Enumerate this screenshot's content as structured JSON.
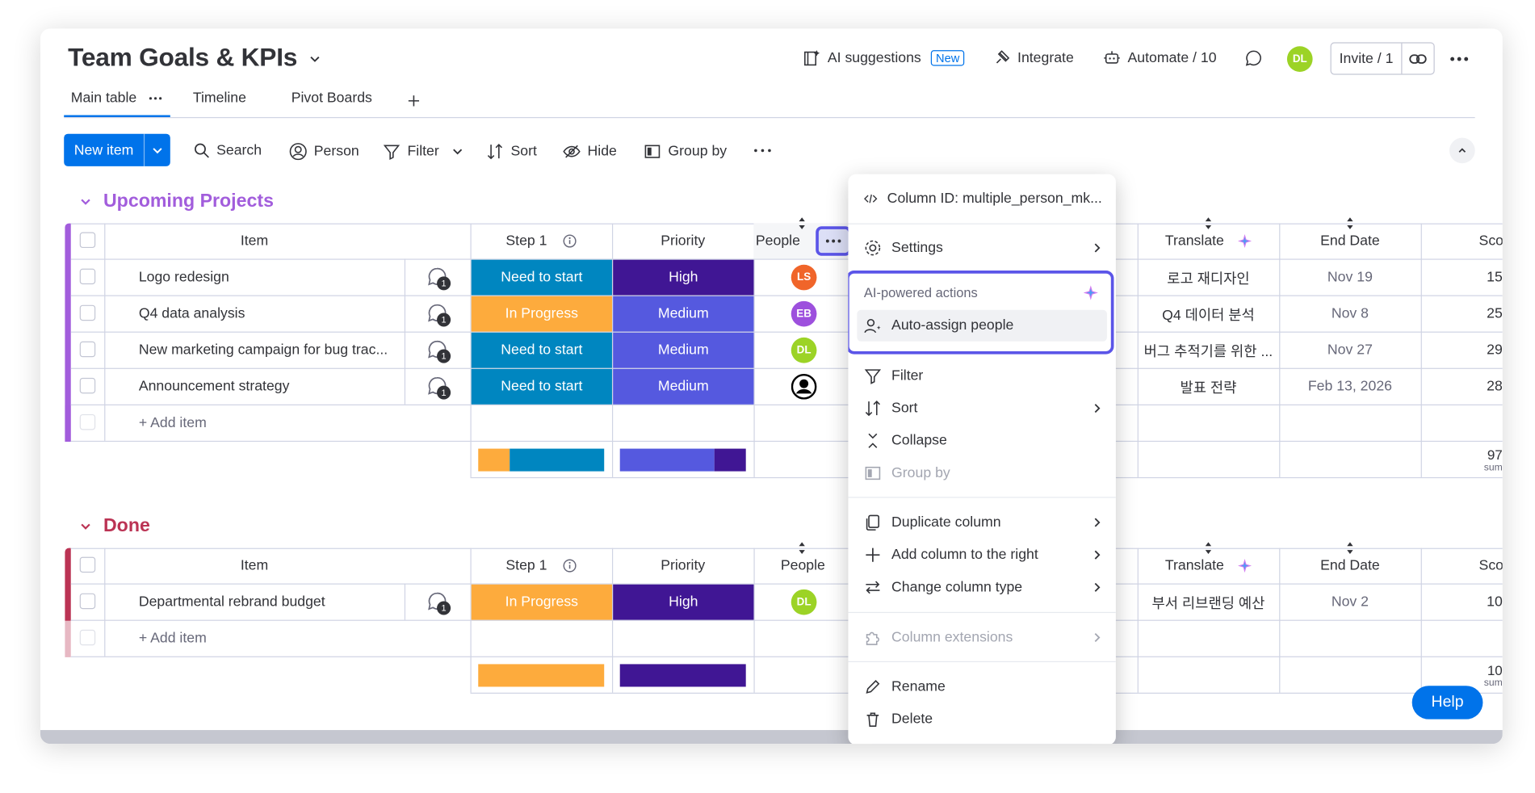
{
  "board": {
    "title": "Team Goals & KPIs",
    "ai_suggestions": "AI suggestions",
    "new_badge": "New",
    "integrate": "Integrate",
    "automate": "Automate / 10",
    "user_initials": "DL",
    "invite": "Invite / 1"
  },
  "tabs": [
    "Main table",
    "Timeline",
    "Pivot Boards"
  ],
  "toolbar": {
    "new_item": "New item",
    "search": "Search",
    "person": "Person",
    "filter": "Filter",
    "sort": "Sort",
    "hide": "Hide",
    "group_by": "Group by"
  },
  "columns": {
    "item": "Item",
    "step1": "Step 1",
    "priority": "Priority",
    "people": "People",
    "translate": "Translate",
    "end_date": "End Date",
    "score": "Score"
  },
  "groups": [
    {
      "name": "Upcoming Projects",
      "color": "#a25ddc",
      "rows": [
        {
          "item": "Logo redesign",
          "updates": "1",
          "step": "Need to start",
          "step_color": "#0086c0",
          "priority": "High",
          "priority_color": "#401694",
          "person": "LS",
          "person_color": "#f0652a",
          "translate": "로고 재디자인",
          "end": "Nov 19",
          "score": "15"
        },
        {
          "item": "Q4 data analysis",
          "updates": "1",
          "step": "In Progress",
          "step_color": "#fdab3d",
          "priority": "Medium",
          "priority_color": "#5559df",
          "person": "EB",
          "person_color": "#9d50dd",
          "translate": "Q4 데이터 분석",
          "end": "Nov 8",
          "score": "25"
        },
        {
          "item": "New marketing campaign for bug trac...",
          "updates": "1",
          "step": "Need to start",
          "step_color": "#0086c0",
          "priority": "Medium",
          "priority_color": "#5559df",
          "person": "DL",
          "person_color": "#9cd326",
          "translate": "버그 추적기를 위한 ...",
          "end": "Nov 27",
          "score": "29"
        },
        {
          "item": "Announcement strategy",
          "updates": "1",
          "step": "Need to start",
          "step_color": "#0086c0",
          "priority": "Medium",
          "priority_color": "#5559df",
          "person": "",
          "person_color": "#ffffff",
          "translate": "발표 전략",
          "end": "Feb 13, 2026",
          "score": "28"
        }
      ],
      "add_item": "+ Add item",
      "summary_score": "97",
      "summary_label": "sum"
    },
    {
      "name": "Done",
      "color": "#bb3354",
      "rows": [
        {
          "item": "Departmental rebrand budget",
          "updates": "1",
          "step": "In Progress",
          "step_color": "#fdab3d",
          "priority": "High",
          "priority_color": "#401694",
          "person": "DL",
          "person_color": "#9cd326",
          "translate": "부서 리브랜딩 예산",
          "end": "Nov 2",
          "score": "10"
        }
      ],
      "add_item": "+ Add item",
      "summary_score": "10",
      "summary_label": "sum"
    }
  ],
  "context_menu": {
    "column_id": "Column ID: multiple_person_mk...",
    "settings": "Settings",
    "ai_section": "AI-powered actions",
    "auto_assign": "Auto-assign people",
    "filter": "Filter",
    "sort": "Sort",
    "collapse": "Collapse",
    "group_by": "Group by",
    "duplicate": "Duplicate column",
    "add_right": "Add column to the right",
    "change_type": "Change column type",
    "extensions": "Column extensions",
    "rename": "Rename",
    "delete": "Delete"
  },
  "help": "Help",
  "colors": {
    "accent": "#0073ea",
    "highlight": "#5b55e8",
    "upcoming": "#a25ddc",
    "done": "#bb3354"
  }
}
